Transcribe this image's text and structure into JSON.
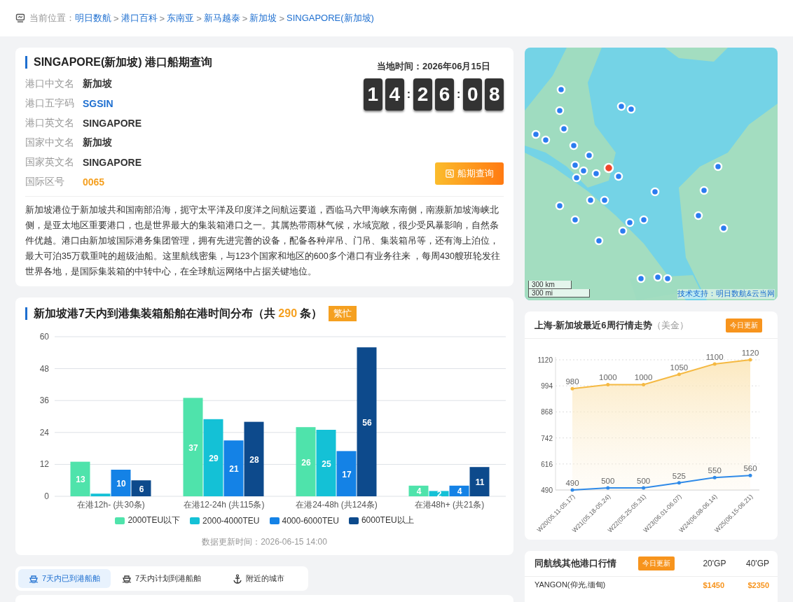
{
  "breadcrumb": {
    "label": "当前位置：",
    "items": [
      "明日数航",
      "港口百科",
      "东南亚",
      "新马越泰",
      "新加坡",
      "SINGAPORE(新加坡)"
    ],
    "separator": ">"
  },
  "port": {
    "title": "SINGAPORE(新加坡) 港口船期查询",
    "fields": [
      {
        "label": "港口中文名",
        "value": "新加坡",
        "kind": "plain"
      },
      {
        "label": "港口五字码",
        "value": "SGSIN",
        "kind": "code"
      },
      {
        "label": "港口英文名",
        "value": "SINGAPORE",
        "kind": "plain"
      },
      {
        "label": "国家中文名",
        "value": "新加坡",
        "kind": "plain"
      },
      {
        "label": "国家英文名",
        "value": "SINGAPORE",
        "kind": "plain"
      },
      {
        "label": "国际区号",
        "value": "0065",
        "kind": "highlight"
      }
    ],
    "local_time": "当地时间：2026年06月15日",
    "clock": {
      "hours": [
        "1",
        "4"
      ],
      "minutes": [
        "2",
        "6"
      ],
      "seconds": [
        "0",
        "8"
      ],
      "separator": ":"
    },
    "schedule_button": "船期查询",
    "description": "新加坡港位于新加坡共和国南部沿海，扼守太平洋及印度洋之间航运要道，西临马六甲海峡东南侧，南濒新加坡海峡北侧，是亚太地区重要港口，也是世界最大的集装箱港口之一。其属热带雨林气候，水域宽敞，很少受风暴影响，自然条件优越。港口由新加坡国际港务集团管理，拥有先进完善的设备，配备各种岸吊、门吊、集装箱吊等，还有海上泊位，最大可泊35万载重吨的超级油船。这里航线密集，与123个国家和地区的600多个港口有业务往来 ，每周430艘班轮发往世界各地，是国际集装箱的中转中心，在全球航运网络中占据关键地位。"
  },
  "map": {
    "kind": "picture",
    "scale": [
      "300 km",
      "300 mi"
    ],
    "attribution": "技术支持：明日数航&云当网"
  },
  "distribution": {
    "title_before": "新加坡港7天内到港集装箱船舶在港时间分布（共",
    "total": "290",
    "title_after": "条）",
    "badge": "繁忙",
    "updated": "数据更新时间：2026-06-15 14:00",
    "chart_data": {
      "type": "bar",
      "categories": [
        "在港12h- (共30条)",
        "在港12-24h (共115条)",
        "在港24-48h (共124条)",
        "在港48h+ (共21条)"
      ],
      "ylim": [
        0,
        60
      ],
      "yticks": [
        0,
        12,
        24,
        36,
        48,
        60
      ],
      "grid": true,
      "legend": "bottom",
      "series": [
        {
          "name": "2000TEU以下",
          "color": "#4fe3ab",
          "values": [
            13,
            37,
            26,
            4
          ],
          "value_labels": [
            "13",
            "37",
            "26",
            "4"
          ]
        },
        {
          "name": "2000-4000TEU",
          "color": "#14c1d6",
          "values": [
            1,
            29,
            25,
            2
          ],
          "value_labels": [
            null,
            "29",
            "25",
            "2"
          ]
        },
        {
          "name": "4000-6000TEU",
          "color": "#1482e6",
          "values": [
            10,
            21,
            17,
            4
          ],
          "value_labels": [
            "10",
            "21",
            "17",
            "4"
          ]
        },
        {
          "name": "6000TEU以上",
          "color": "#0d4a8c",
          "values": [
            6,
            28,
            56,
            11
          ],
          "value_labels": [
            "6",
            "28",
            "56",
            "11"
          ]
        }
      ]
    }
  },
  "trend": {
    "title": "上海-新加坡最近6周行情走势",
    "unit": "（美金）",
    "badge": "今日更新",
    "chart_data": {
      "type": "line",
      "categories": [
        "W20(05.11-05.17)",
        "W21(05.18-05.24)",
        "W22(05.25-05.31)",
        "W23(06.01-06.07)",
        "W24(06.08-06.14)",
        "W25(06.15-06.21)"
      ],
      "ylim": [
        490,
        1120
      ],
      "yticks": [
        490,
        616,
        742,
        868,
        994,
        1120
      ],
      "data_labels": true,
      "grid": true,
      "series": [
        {
          "color": "#f5b942",
          "values": [
            980,
            1000,
            1000,
            1050,
            1100,
            1120
          ]
        },
        {
          "color": "#2f8ae8",
          "values": [
            490,
            500,
            500,
            525,
            550,
            560
          ]
        }
      ]
    }
  },
  "tabs": [
    {
      "label": "7天内已到港船舶",
      "selected": true
    },
    {
      "label": "7天内计划到港船舶",
      "selected": false
    },
    {
      "label": "附近的城市",
      "selected": false
    }
  ],
  "route_prices": {
    "title": "同航线其他港口行情",
    "badge": "今日更新",
    "columns": [
      "20'GP",
      "40'GP"
    ],
    "rows": [
      {
        "port": "YANGON(仰光,缅甸)",
        "prices": [
          "$1450",
          "$2350"
        ]
      }
    ]
  }
}
